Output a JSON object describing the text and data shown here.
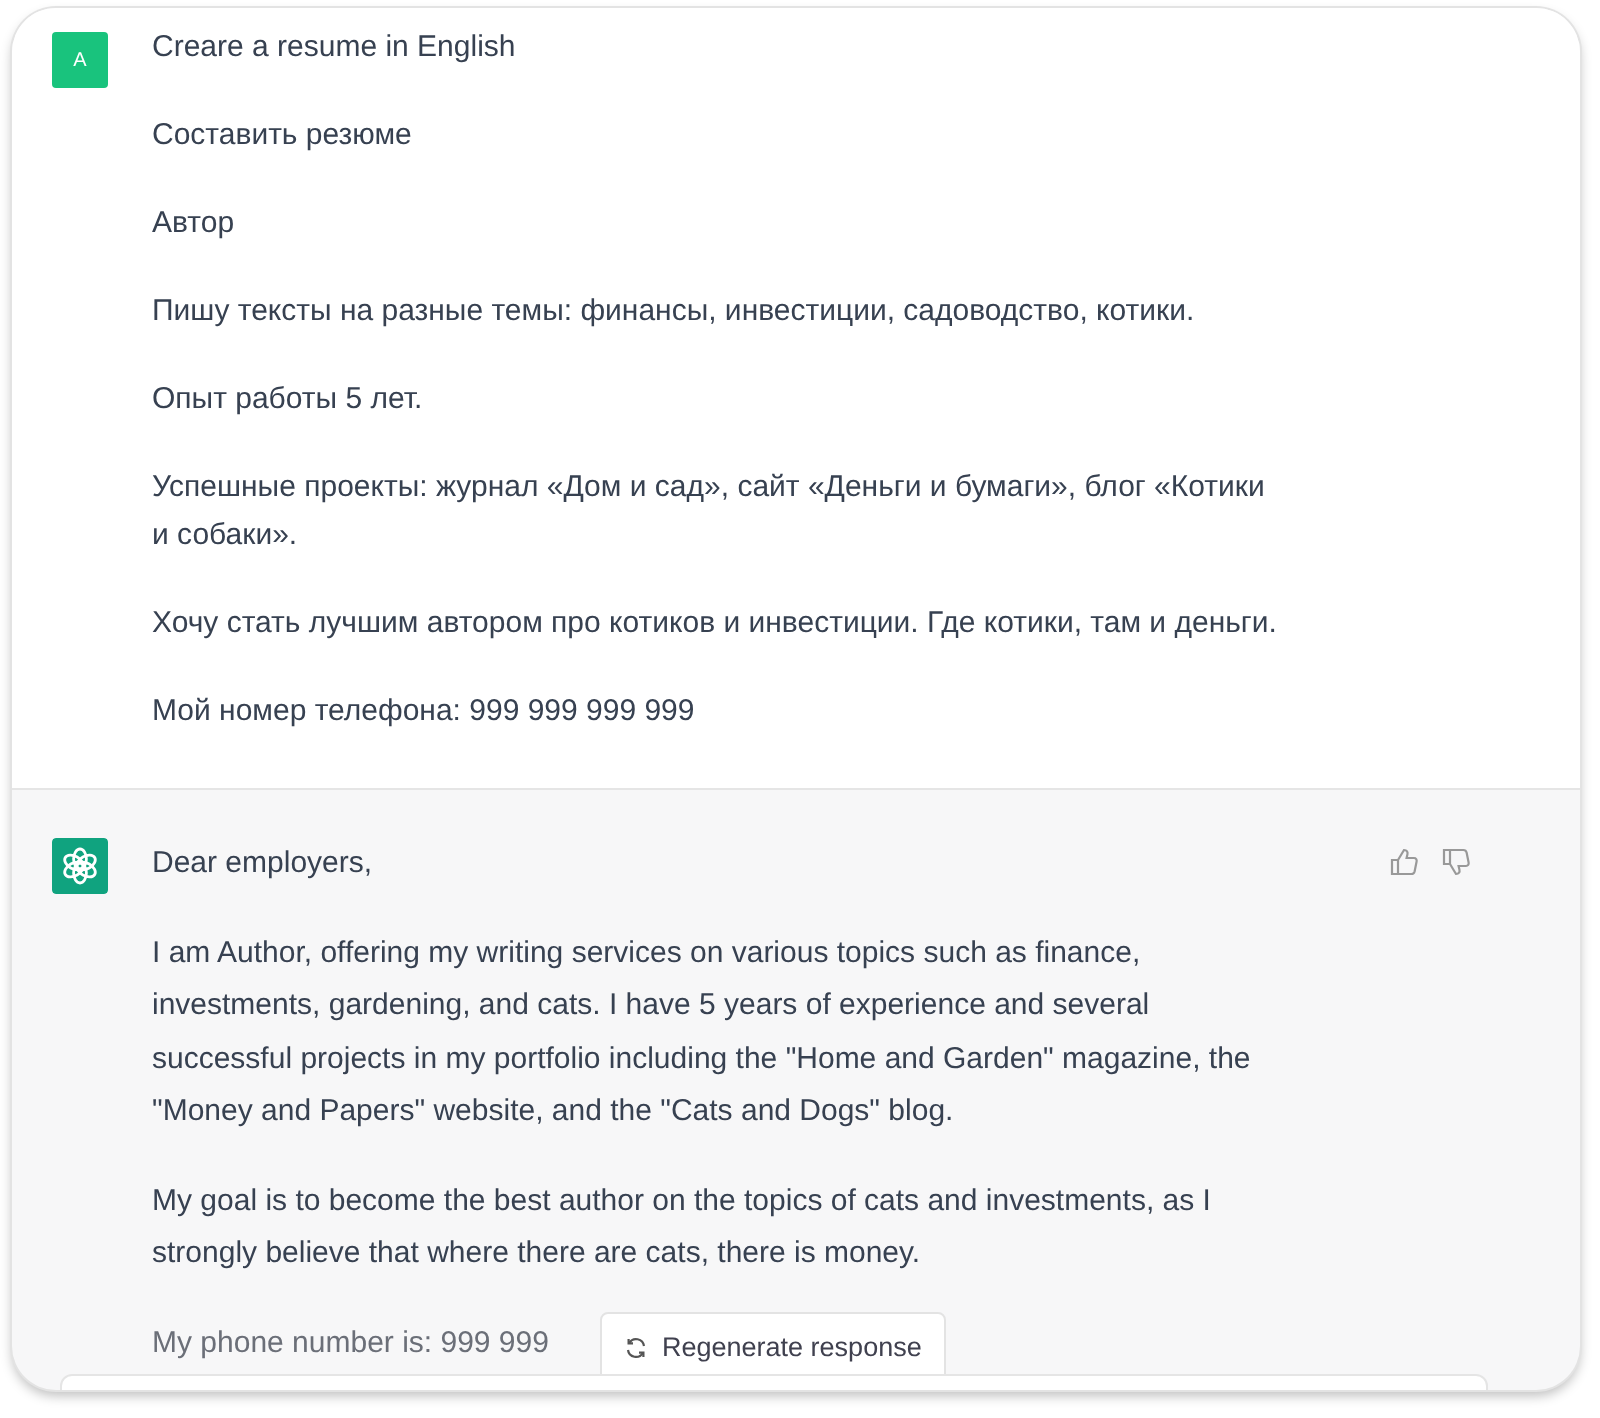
{
  "user_message": {
    "avatar": "A",
    "paragraphs": [
      "Creare a resume in English",
      "Составить резюме",
      "Автор",
      "Пишу тексты на разные темы: финансы, инвестиции, садоводство, котики.",
      "Опыт работы 5 лет.",
      "Успешные проекты: журнал «Дом и сад», сайт «Деньги и бумаги», блог «Котики и собаки».",
      "Хочу стать лучшим автором про котиков и инвестиции. Где котики, там и деньги.",
      "Мой номер телефона: 999 999 999 999"
    ]
  },
  "assistant_message": {
    "paragraphs": [
      "Dear employers,",
      "I am Author, offering my writing services on various topics such as finance, investments, gardening, and cats. I have 5 years of experience and several successful projects in my portfolio including the \"Home and Garden\" magazine, the \"Money and Papers\" website, and the \"Cats and Dogs\" blog.",
      "My goal is to become the best author on the topics of cats and investments, as I strongly believe that where there are cats, there is money.",
      "My phone number is: 999 999"
    ]
  },
  "regenerate_button": {
    "label": "Regenerate response"
  }
}
